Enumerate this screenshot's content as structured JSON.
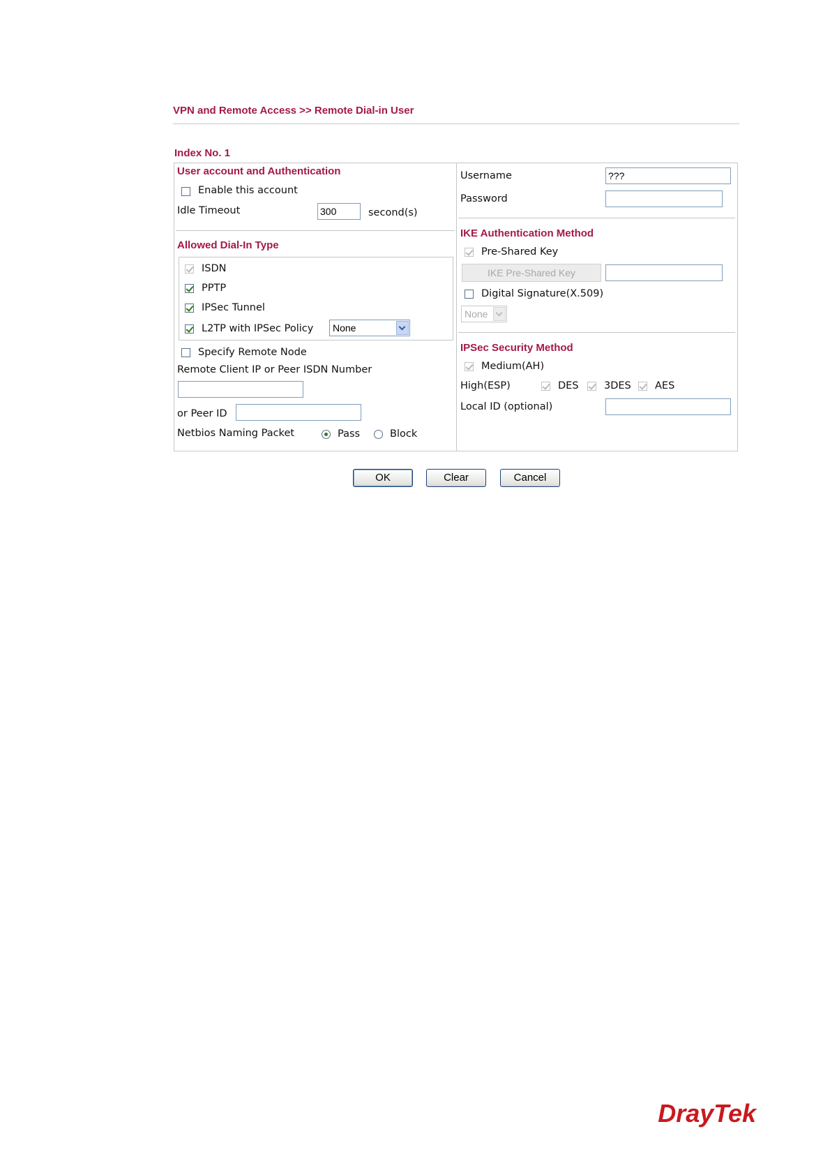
{
  "breadcrumb": "VPN and Remote Access >> Remote Dial-in User",
  "index_label": "Index No. 1",
  "left": {
    "auth_title": "User account and Authentication",
    "enable_account": {
      "label": "Enable this account",
      "checked": false
    },
    "idle_timeout": {
      "label": "Idle Timeout",
      "value": "300",
      "unit": "second(s)"
    },
    "dialin_title": "Allowed Dial-In Type",
    "dialin_types": [
      {
        "label": "ISDN",
        "checked": true,
        "disabled": true
      },
      {
        "label": "PPTP",
        "checked": true,
        "disabled": false
      },
      {
        "label": "IPSec Tunnel",
        "checked": true,
        "disabled": false
      },
      {
        "label": "L2TP with IPSec Policy",
        "checked": true,
        "disabled": false
      }
    ],
    "l2tp_policy_selected": "None",
    "specify_remote_node": {
      "label": "Specify Remote Node",
      "checked": false
    },
    "remote_client_label": "Remote Client IP or Peer ISDN Number",
    "remote_client_value": "",
    "peer_id_label": "or Peer ID",
    "peer_id_value": "",
    "netbios": {
      "label": "Netbios Naming Packet",
      "pass_label": "Pass",
      "block_label": "Block",
      "selected": "Pass"
    }
  },
  "right": {
    "username_label": "Username",
    "username_value": "???",
    "password_label": "Password",
    "password_value": "",
    "ike_title": "IKE Authentication Method",
    "pre_shared_key": {
      "label": "Pre-Shared Key",
      "checked": true,
      "disabled": true
    },
    "ike_psk_button": "IKE Pre-Shared Key",
    "ike_psk_value": "",
    "digital_signature": {
      "label": "Digital Signature(X.509)",
      "checked": false
    },
    "signature_selected": "None",
    "ipsec_title": "IPSec Security Method",
    "medium_ah": {
      "label": "Medium(AH)",
      "checked": true,
      "disabled": true
    },
    "high_esp_label": "High(ESP)",
    "esp_options": [
      {
        "label": "DES",
        "checked": true
      },
      {
        "label": "3DES",
        "checked": true
      },
      {
        "label": "AES",
        "checked": true
      }
    ],
    "local_id_label": "Local ID (optional)",
    "local_id_value": ""
  },
  "buttons": {
    "ok": "OK",
    "clear": "Clear",
    "cancel": "Cancel"
  },
  "logo_text": "DrayTek",
  "colors": {
    "accent": "#a3194a",
    "border": "#c6c6c6",
    "check": "#2f7a1f",
    "logo": "#c8191f"
  }
}
